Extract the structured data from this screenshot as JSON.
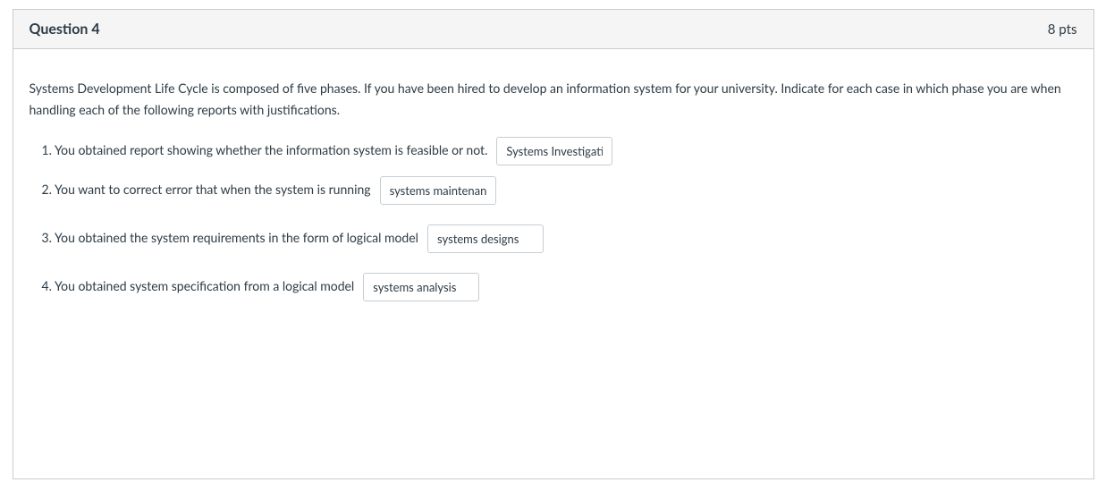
{
  "question": {
    "title": "Question 4",
    "points": "8 pts",
    "prompt": "Systems Development Life Cycle is composed of five phases. If you have been hired to develop an information system for your university. Indicate for each case in which phase you are when handling each of the following reports with justifications.",
    "items": [
      {
        "text": "1. You obtained report showing whether the information system is feasible or not.",
        "value": "Systems Investigation"
      },
      {
        "text": "2. You want to correct error that when the system is running",
        "value": "systems maintenance"
      },
      {
        "text": "3. You obtained the system requirements in the form of logical model",
        "value": "systems designs"
      },
      {
        "text": "4. You obtained system specification from a logical model",
        "value": "systems analysis"
      }
    ]
  }
}
